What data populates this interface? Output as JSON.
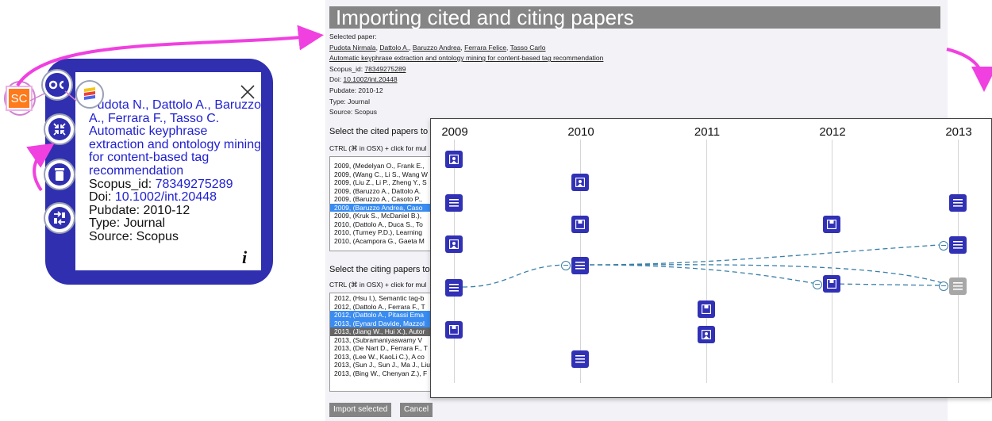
{
  "card": {
    "authors": "Pudota N., Dattolo A., Baruzzo A., Ferrara F., Tasso C.",
    "title": "Automatic keyphrase extraction and ontology mining for content-based tag recommendation",
    "scopus_label": "Scopus_id: ",
    "scopus_value": "78349275289",
    "doi_label": "Doi: ",
    "doi_value": "10.1002/int.20448",
    "pubdate": "Pubdate: 2010-12",
    "type": "Type: Journal",
    "source": "Source: Scopus",
    "sc_badge": "SC",
    "icons": [
      "oc-icon",
      "mendeley-icon",
      "shrink-icon",
      "trash-icon",
      "swap-icon",
      "close-icon",
      "info-icon"
    ]
  },
  "panel": {
    "title": "Importing cited and citing papers",
    "selected_label": "Selected paper:",
    "authors_links": [
      "Pudota Nirmala",
      "Dattolo A.",
      "Baruzzo Andrea",
      "Ferrara Felice",
      "Tasso Carlo"
    ],
    "paper_title": "Automatic keyphrase extraction and ontology mining for content-based tag recommendation",
    "scopus_label": "Scopus_id: ",
    "scopus_value": "78349275289",
    "doi_label": "Doi: ",
    "doi_value": "10.1002/int.20448",
    "pubdate": "Pubdate: 2010-12",
    "type": "Type: Journal",
    "source": "Source: Scopus",
    "cited_title": "Select the cited papers to",
    "cited_hint": "CTRL (⌘ in OSX) + click for mul",
    "cited_items": [
      "2009, (Medelyan O., Frank E.,",
      "2009, (Wang C., Li S., Wang W",
      "2009, (Liu Z., Li P., Zheng Y., S",
      "2009, (Baruzzo A., Dattolo A.",
      "2009, (Baruzzo A., Casoto P.,",
      "2009, (Baruzzo Andrea, Caso",
      "2009, (Kruk S., McDaniel B.),",
      "2010, (Dattolo A., Duca S., To",
      "2010, (Turney P.D.), Learning",
      "2010, (Acampora G., Gaeta M"
    ],
    "citing_title": "Select the citing papers to",
    "citing_hint": "CTRL (⌘ in OSX) + click for mul",
    "citing_items": [
      "2012, (Hsu I.), Semantic tag-b",
      "2012, (Dattolo A., Ferrara F., T",
      "2012, (Dattolo A., Pitassi Ema",
      "2013, (Eynard Davide, Mazzol",
      "2013, (Jiang W., Hui X.), Autor",
      "2013, (Subramaniyaswamy V",
      "2013, (De Nart D., Ferrara F., T",
      "2013, (Lee W., KaoLi C.), A co",
      "2013, (Sun J., Sun J., Ma J., Liu",
      "2013, (Bing W., Chenyan Z.), F"
    ],
    "import_button": "Import selected",
    "cancel_button": "Cancel"
  },
  "timeline": {
    "years": [
      "2009",
      "2010",
      "2011",
      "2012",
      "2013"
    ],
    "colors": {
      "node": "#3131b6",
      "node_gray": "#a7a7a7",
      "link": "#3a7fa8"
    }
  }
}
